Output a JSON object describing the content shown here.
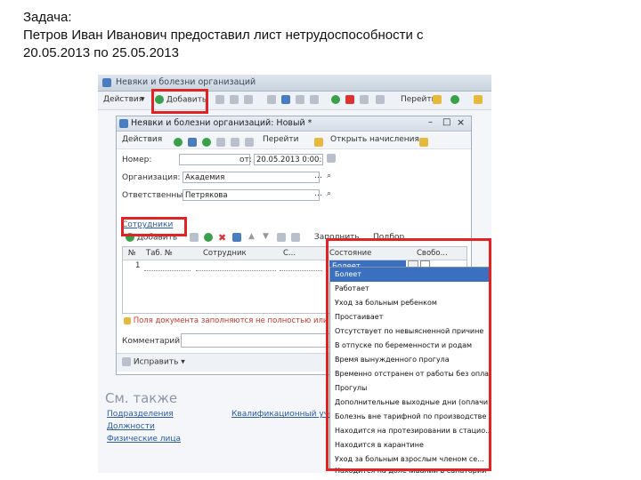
{
  "task": {
    "heading": "Задача:",
    "line1": "Петров Иван Иванович предоставил лист нетрудоспособности с",
    "line2": "20.05.2013 по 25.05.2013"
  },
  "outer_window": {
    "title": "Невяки и болезни организаций",
    "toolbar": {
      "actions": "Действия",
      "add": "Добавить",
      "go": "Перейти"
    }
  },
  "doc_window": {
    "title": "Неявки и болезни организаций: Новый *",
    "toolbar": {
      "actions": "Действия",
      "go": "Перейти",
      "open_calc": "Открыть начисления"
    },
    "fields": {
      "number_label": "Номер:",
      "date_label": "от:",
      "date_value": "20.05.2013 0:00:00",
      "org_label": "Организация:",
      "org_value": "Академия",
      "resp_label": "Ответственный:",
      "resp_value": "Петрякова"
    },
    "employees": {
      "section": "Сотрудники",
      "add": "Добавить",
      "fill": "Заполнить",
      "select": "Подбор",
      "columns": [
        "№",
        "Таб. №",
        "Сотрудник",
        "С...",
        "Состояние",
        "Свобо..."
      ],
      "row_num": "1",
      "state_value": "Болеет"
    },
    "warning": "Поля документа заполняются не полностью или неп",
    "comment_label": "Комментарий:",
    "fix": "Исправить"
  },
  "see_also": {
    "title": "См. также",
    "links": [
      "Подразделения",
      "Должности",
      "Физические лица",
      "Квалификационный учет"
    ]
  },
  "dropdown": {
    "items": [
      "Болеет",
      "Работает",
      "Уход за больным ребенком",
      "Простаивает",
      "Отсутствует по невыясненной причине",
      "В отпуске по беременности и родам",
      "Время вынужденного прогула",
      "Временно отстранен от работы без оплаты",
      "Прогулы",
      "Дополнительные выходные дни (оплачи...",
      "Болезнь вне тарифной по производстве",
      "Находится на протезировании в стацио...",
      "Находится в карантине",
      "Уход за больным взрослым членом се...",
      "Находится на долечивании в санатории"
    ],
    "selected_index": 0
  },
  "colors": {
    "highlight": "#e02424",
    "link": "#2a5ba8",
    "selection": "#3b6fbf"
  }
}
